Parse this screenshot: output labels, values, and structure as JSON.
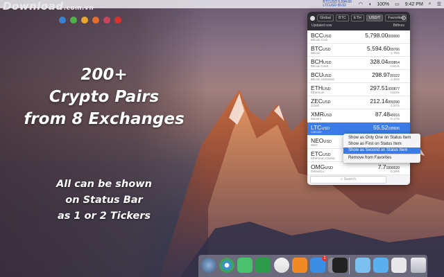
{
  "watermark": {
    "brand": "Download",
    "suffix": ".com.vn"
  },
  "headline": {
    "line1": "200+",
    "line2": "Crypto Pairs",
    "line3": "from 8 Exchanges"
  },
  "subline": {
    "line1": "All can be shown",
    "line2": "on Status Bar",
    "line3": "as 1 or 2 Tickers"
  },
  "menubar": {
    "ticker_line1": "BTCUSD 5,594.60",
    "ticker_line2": "LTCUSD 55.52",
    "battery": "100%",
    "time": "9:42 PM"
  },
  "panel": {
    "tabs": [
      {
        "label": "Global",
        "selected": false
      },
      {
        "label": "BTC",
        "selected": false
      },
      {
        "label": "ETH",
        "selected": false
      },
      {
        "label": "USD/T",
        "selected": true
      },
      {
        "label": "Favorites",
        "selected": false
      }
    ],
    "gear_icon": "gear-icon",
    "updated": "Updated now",
    "exchange": "Bitfinex",
    "rows": [
      {
        "sym": "BCC",
        "quote": "USD",
        "name": "Bitcoin Core",
        "price": "5,798.00",
        "price_small": "000000",
        "change": "",
        "selected": false
      },
      {
        "sym": "BTC",
        "quote": "USD",
        "name": "Bitcoin",
        "price": "5,594.60",
        "price_small": "09766",
        "change": "-2.76%",
        "selected": false
      },
      {
        "sym": "BCH",
        "quote": "USD",
        "name": "Bitcoin Cash",
        "price": "328.04",
        "price_small": "000854",
        "change": "-0.81%",
        "selected": false
      },
      {
        "sym": "BCU",
        "quote": "USD",
        "name": "Bitcoin Unlimited",
        "price": "298.97",
        "price_small": "00122",
        "change": "4.30%",
        "selected": false
      },
      {
        "sym": "ETH",
        "quote": "USD",
        "name": "Ethereum",
        "price": "297.51",
        "price_small": "000877",
        "change": "-3.64%",
        "selected": false
      },
      {
        "sym": "ZEC",
        "quote": "USD",
        "name": "Zcash",
        "price": "212.14",
        "price_small": "899390",
        "change": "-1.97%",
        "selected": false
      },
      {
        "sym": "XMR",
        "quote": "USD",
        "name": "Monero",
        "price": "87.48",
        "price_small": "40016",
        "change": "-5.17%",
        "selected": false
      },
      {
        "sym": "LTC",
        "quote": "USD",
        "name": "Litecoin",
        "price": "55.52",
        "price_small": "199936",
        "change": "",
        "selected": true
      },
      {
        "sym": "NEO",
        "quote": "USD",
        "name": "NEO",
        "price": "",
        "price_small": "",
        "change": "",
        "selected": false
      },
      {
        "sym": "ETC",
        "quote": "USD",
        "name": "Ethereum Classic",
        "price": "",
        "price_small": "",
        "change": "",
        "selected": false
      },
      {
        "sym": "OMG",
        "quote": "USD",
        "name": "OmiseGo",
        "price": "7.7",
        "price_small": "1890020",
        "change": "-5.39%",
        "selected": false
      }
    ],
    "search_placeholder": "Search"
  },
  "context_menu": {
    "items": [
      {
        "label": "Show as Only One on Status Item",
        "selected": false
      },
      {
        "label": "Show as First on Status Item",
        "selected": false
      },
      {
        "label": "Show as Second on Status Item",
        "selected": true
      },
      {
        "label": "Remove from Favorites",
        "selected": false
      }
    ]
  },
  "colors": {
    "accent": "#3b7be8",
    "panel_header": "#2d2d33"
  },
  "dock": {
    "icons": [
      "finder-icon",
      "chrome-icon",
      "messages-icon",
      "facetime-icon",
      "itunes-icon",
      "ibooks-icon",
      "appstore-icon",
      "system-preferences-icon",
      "terminal-icon",
      "folder-icon",
      "folder-icon",
      "preview-icon",
      "trash-icon"
    ],
    "appstore_badge": "1"
  }
}
